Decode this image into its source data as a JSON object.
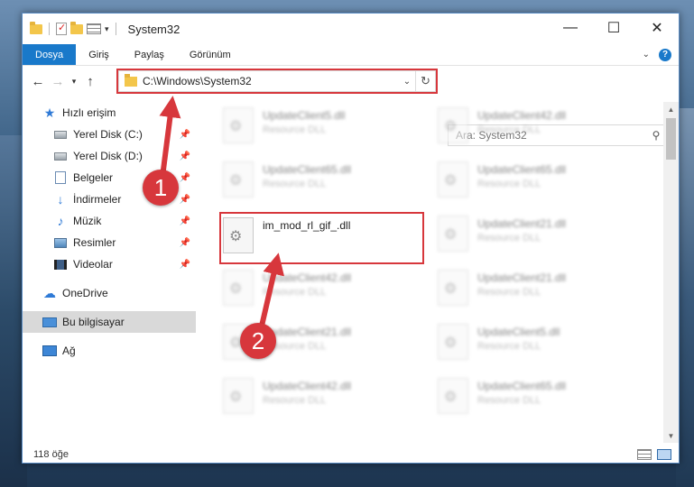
{
  "window": {
    "title": "System32"
  },
  "controls": {
    "minimize": "—",
    "maximize": "☐",
    "close": "✕"
  },
  "ribbon": {
    "tabs": [
      {
        "label": "Dosya",
        "active": true
      },
      {
        "label": "Giriş"
      },
      {
        "label": "Paylaş"
      },
      {
        "label": "Görünüm"
      }
    ],
    "help": "?"
  },
  "nav": {
    "address": "C:\\Windows\\System32",
    "search_placeholder": "Ara: System32"
  },
  "sidebar": {
    "items": [
      {
        "label": "Hızlı erişim",
        "icon": "star-icon"
      },
      {
        "label": "Yerel Disk (C:)",
        "icon": "disk-icon",
        "pinned": true
      },
      {
        "label": "Yerel Disk (D:)",
        "icon": "disk-icon",
        "pinned": true
      },
      {
        "label": "Belgeler",
        "icon": "documents-icon",
        "pinned": true
      },
      {
        "label": "İndirmeler",
        "icon": "downloads-icon",
        "pinned": true
      },
      {
        "label": "Müzik",
        "icon": "music-icon",
        "pinned": true
      },
      {
        "label": "Resimler",
        "icon": "pictures-icon",
        "pinned": true
      },
      {
        "label": "Videolar",
        "icon": "videos-icon",
        "pinned": true
      },
      {
        "label": "OneDrive",
        "icon": "cloud-icon"
      },
      {
        "label": "Bu bilgisayar",
        "icon": "computer-icon",
        "selected": true
      },
      {
        "label": "Ağ",
        "icon": "network-icon"
      }
    ]
  },
  "files": {
    "highlighted": {
      "name": "im_mod_rl_gif_.dll",
      "type": ""
    },
    "left_column": [
      {
        "name": "UpdateClient5.dll",
        "type": "Resource DLL"
      },
      {
        "name": "UpdateClient65.dll",
        "type": "Resource DLL"
      },
      {
        "name": "UpdateClient42.dll",
        "type": "Resource DLL"
      },
      {
        "name": "UpdateClient21.dll",
        "type": "Resource DLL"
      },
      {
        "name": "UpdateClient42.dll",
        "type": "Resource DLL"
      }
    ],
    "right_column": [
      {
        "name": "UpdateClient42.dll",
        "type": "Resource DLL"
      },
      {
        "name": "UpdateClient65.dll",
        "type": "Resource DLL"
      },
      {
        "name": "UpdateClient21.dll",
        "type": "Resource DLL"
      },
      {
        "name": "UpdateClient21.dll",
        "type": "Resource DLL"
      },
      {
        "name": "UpdateClient5.dll",
        "type": "Resource DLL"
      },
      {
        "name": "UpdateClient65.dll",
        "type": "Resource DLL"
      }
    ]
  },
  "status": {
    "count": "118 öğe"
  },
  "annotations": {
    "step1": "1",
    "step2": "2",
    "color": "#d7373c"
  }
}
